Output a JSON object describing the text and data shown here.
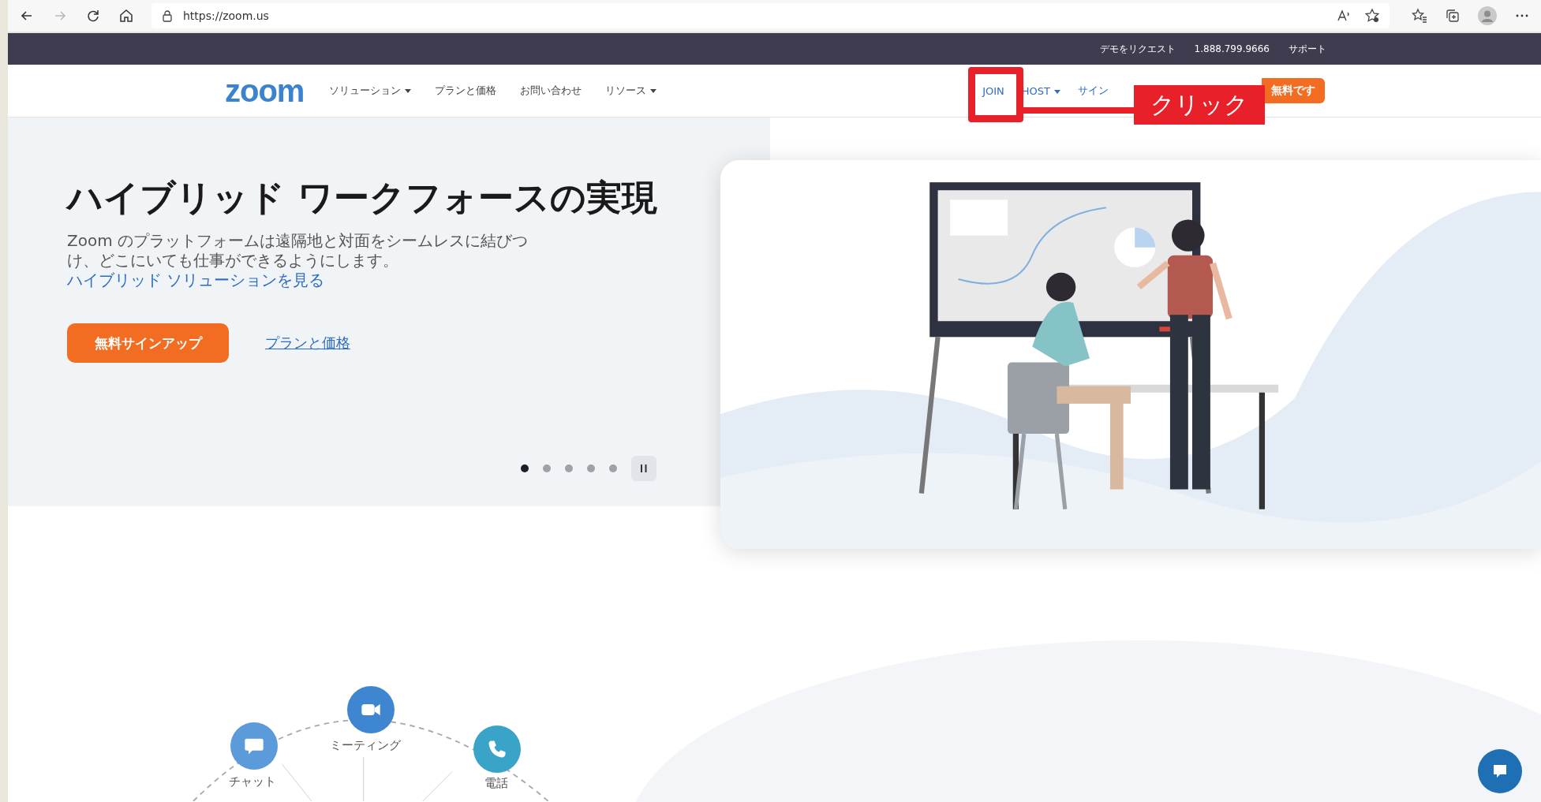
{
  "browser": {
    "url": "https://zoom.us"
  },
  "top_bar": {
    "links": [
      "デモをリクエスト",
      "1.888.799.9666",
      "サポート"
    ]
  },
  "nav": {
    "logo": "zoom",
    "menu": [
      {
        "label": "ソリューション",
        "dropdown": true
      },
      {
        "label": "プランと価格",
        "dropdown": false
      },
      {
        "label": "お問い合わせ",
        "dropdown": false
      },
      {
        "label": "リソース",
        "dropdown": true
      }
    ],
    "right": [
      {
        "label": "JOIN",
        "dropdown": false
      },
      {
        "label": "HOST",
        "dropdown": true
      },
      {
        "label": "サイン",
        "dropdown": false
      }
    ],
    "cta": "無料です"
  },
  "annotation": {
    "label": "クリック"
  },
  "hero": {
    "title": "ハイブリッド ワークフォースの実現",
    "text": "Zoom のプラットフォームは遠隔地と対面をシームレスに結びつけ、どこにいても仕事ができるようにします。",
    "link": "ハイブリッド ソリューションを見る",
    "primary_button": "無料サインアップ",
    "secondary_link": "プランと価格",
    "slides": [
      {
        "selected": true
      },
      {
        "selected": false
      },
      {
        "selected": false
      },
      {
        "selected": false
      },
      {
        "selected": false
      }
    ]
  },
  "features": [
    {
      "label": "チャット",
      "kind": "chat"
    },
    {
      "label": "ミーティング",
      "kind": "video"
    },
    {
      "label": "電話",
      "kind": "phone"
    }
  ]
}
